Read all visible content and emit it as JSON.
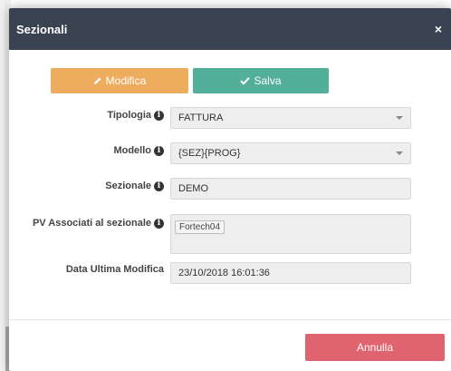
{
  "dialog": {
    "title": "Sezionali",
    "close_label": "×"
  },
  "toolbar": {
    "modifica_label": "Modifica",
    "salva_label": "Salva"
  },
  "form": {
    "tipologia": {
      "label": "Tipologia",
      "value": "FATTURA"
    },
    "modello": {
      "label": "Modello",
      "value": "{SEZ}{PROG}"
    },
    "sezionale": {
      "label": "Sezionale",
      "value": "DEMO"
    },
    "pv_associati": {
      "label": "PV Associati al sezionale",
      "tags": [
        "Fortech04"
      ]
    },
    "data_ultima_modifica": {
      "label": "Data Ultima Modifica",
      "value": "23/10/2018 16:01:36"
    }
  },
  "footer": {
    "annulla_label": "Annulla"
  },
  "colors": {
    "header": "#3a4352",
    "modifica": "#eeac5e",
    "salva": "#52b09a",
    "annulla": "#e06470"
  },
  "icons": [
    "pencil-icon",
    "check-icon",
    "info-icon",
    "close-icon",
    "caret-down-icon"
  ]
}
